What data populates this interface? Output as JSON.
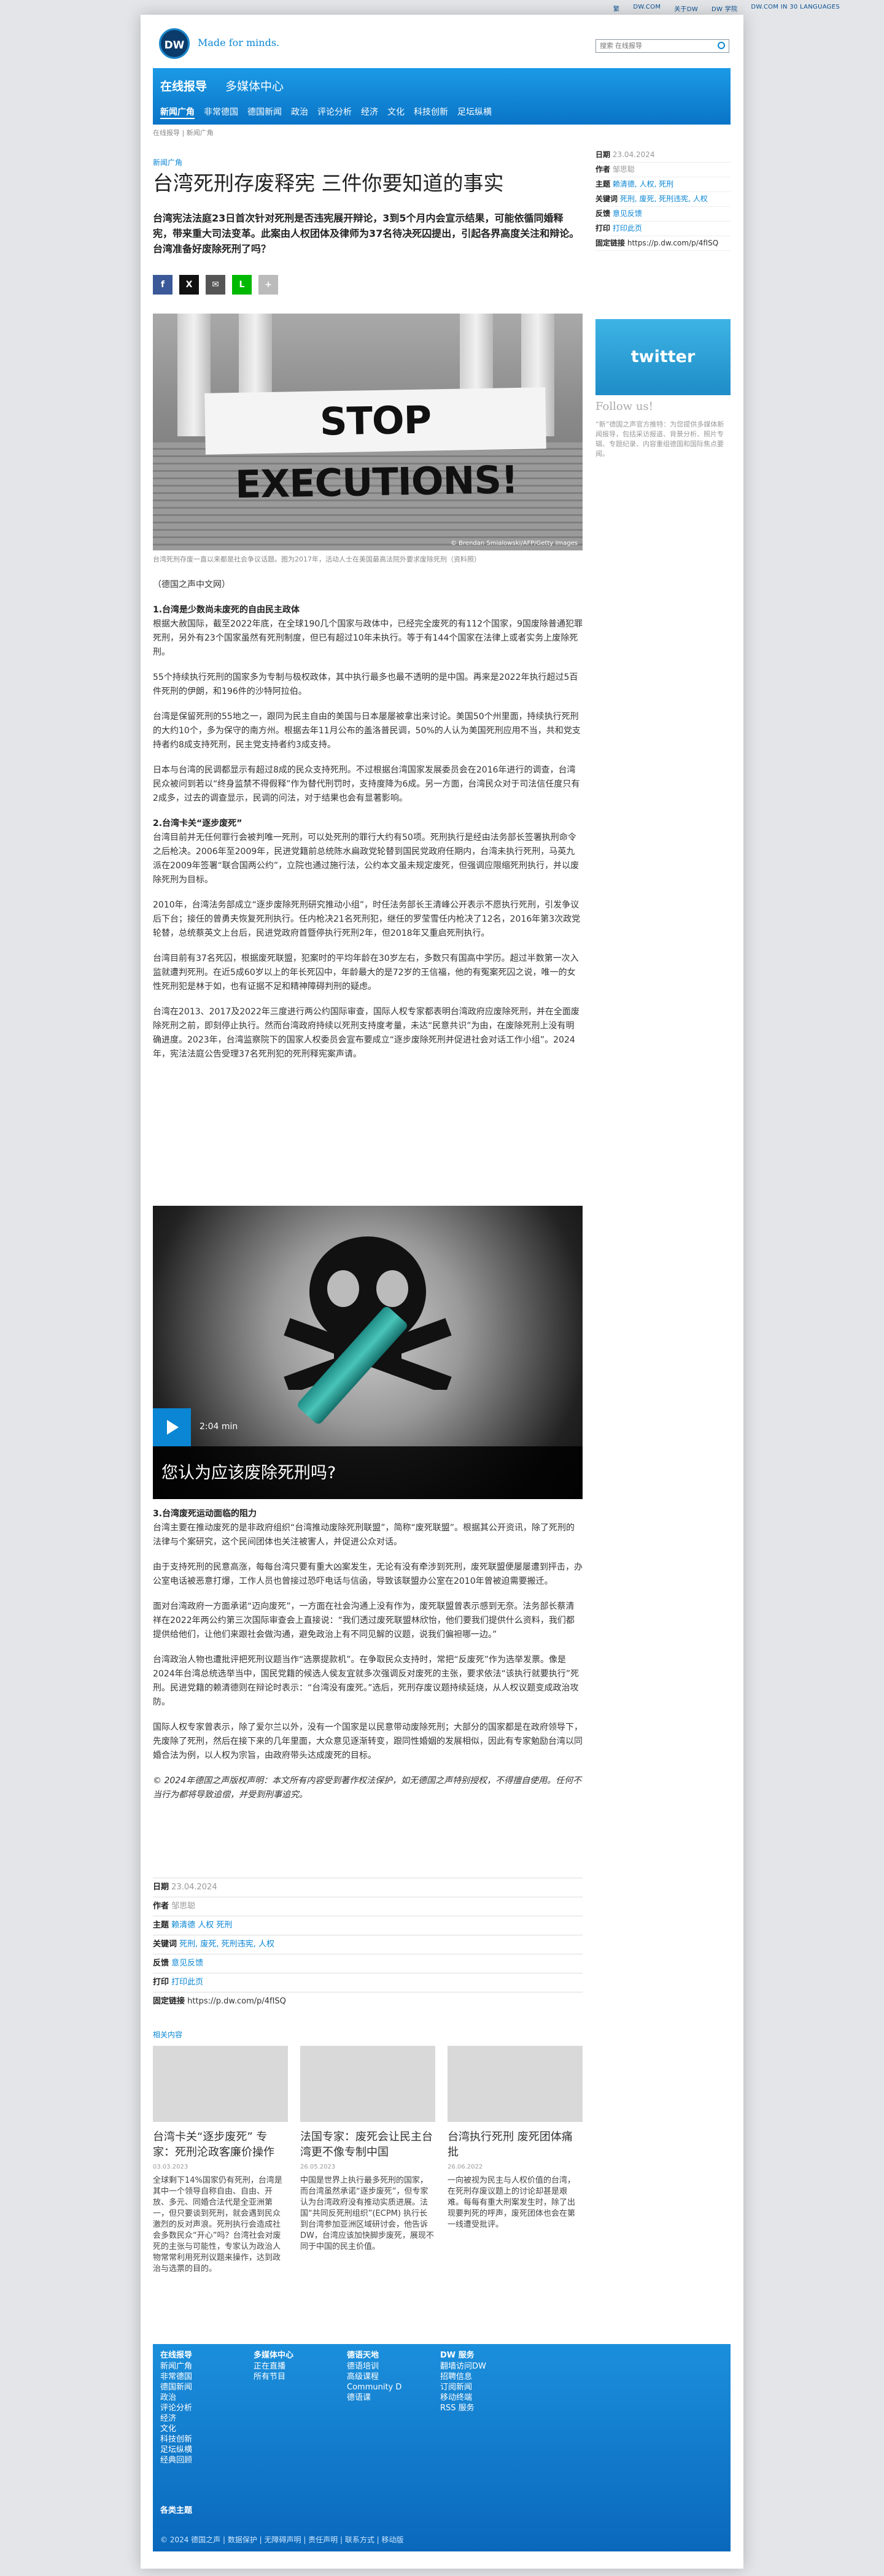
{
  "toplinks": [
    "繁",
    "DW.COM",
    "关于DW",
    "DW 学院",
    "DW.COM IN 30 LANGUAGES"
  ],
  "header": {
    "logo": "DW",
    "tagline": "Made for minds.",
    "search_placeholder": "搜索 在线报导"
  },
  "nav": {
    "title": "在线报导",
    "subtitle": "多媒体中心",
    "items": [
      "新闻广角",
      "非常德国",
      "德国新闻",
      "政治",
      "评论分析",
      "经济",
      "文化",
      "科技创新",
      "足坛纵横"
    ]
  },
  "breadcrumb": "在线报导 | 新闻广角",
  "article": {
    "kicker": "新闻广角",
    "title": "台湾死刑存废释宪 三件你要知道的事实",
    "lead": "台湾宪法法庭23日首次针对死刑是否违宪展开辩论，3到5个月内会宣示结果，可能依循同婚释宪，带来重大司法变革。此案由人权团体及律师为37名待决死囚提出，引起各界高度关注和辩论。台湾准备好废除死刑了吗？",
    "share": [
      "f",
      "X",
      "✉",
      "L",
      "+"
    ],
    "photo_banner": "STOP EXECUTIONS!",
    "photo_credit": "© Brendan Smialowski/AFP/Getty Images",
    "caption": "台湾死刑存废一直以来都是社会争议话题。图为2017年，活动人士在美国最高法院外要求废除死刑（资料照）",
    "sections": [
      {
        "h": "",
        "p": [
          "（德国之声中文网）"
        ]
      },
      {
        "h": "1.台湾是少数尚未废死的自由民主政体",
        "p": [
          "根据大赦国际，截至2022年底，在全球190几个国家与政体中，已经完全废死的有112个国家，9国废除普通犯罪死刑，另外有23个国家虽然有死刑制度，但已有超过10年未执行。等于有144个国家在法律上或者实务上废除死刑。",
          "55个持续执行死刑的国家多为专制与极权政体，其中执行最多也最不透明的是中国。再来是2022年执行超过5百件死刑的伊朗，和196件的沙特阿拉伯。",
          "台湾是保留死刑的55地之一，跟同为民主自由的美国与日本屡屡被拿出来讨论。美国50个州里面，持续执行死刑的大约10个，多为保守的南方州。根据去年11月公布的盖洛普民调，50%的人认为美国死刑应用不当，共和党支持者约8成支持死刑，民主党支持者约3成支持。",
          "日本与台湾的民调都显示有超过8成的民众支持死刑。不过根据台湾国家发展委员会在2016年进行的调查，台湾民众被问到若以“终身监禁不得假释”作为替代刑罚时，支持度降为6成。另一方面，台湾民众对于司法信任度只有2成多，过去的调查显示，民调的问法，对于结果也会有显著影响。"
        ]
      },
      {
        "h": "2.台湾卡关“逐步废死”",
        "p": [
          "台湾目前并无任何罪行会被判唯一死刑，可以处死刑的罪行大约有50项。死刑执行是经由法务部长签署执刑命令之后枪决。2006年至2009年，民进党籍前总统陈水扁政党轮替到国民党政府任期内，台湾未执行死刑，马英九派在2009年签署“联合国两公约”，立院也通过施行法，公约本文虽未规定废死，但强调应限缩死刑执行，并以废除死刑为目标。",
          "2010年，台湾法务部成立“逐步废除死刑研究推动小组”，时任法务部长王清峰公开表示不愿执行死刑，引发争议后下台；接任的曾勇夫恢复死刑执行。任内枪决21名死刑犯，继任的罗莹雪任内枪决了12名，2016年第3次政党轮替，总统蔡英文上台后，民进党政府首暨停执行死刑2年，但2018年又重启死刑执行。",
          "台湾目前有37名死囚，根据废死联盟，犯案时的平均年龄在30岁左右，多数只有国高中学历。超过半数第一次入监就遭判死刑。在近5成60岁以上的年长死囚中，年龄最大的是72岁的王信福，他的有冤案死囚之说，唯一的女性死刑犯是林于如，也有证据不足和精神障碍判刑的疑虑。",
          "台湾在2013、2017及2022年三度进行两公约国际审查，国际人权专家都表明台湾政府应废除死刑，并在全面废除死刑之前，即刻停止执行。然而台湾政府持续以死刑支持度考量，未达“民意共识”为由，在废除死刑上没有明确进度。2023年，台湾监察院下的国家人权委员会宣布要成立“逐步废除死刑并促进社会对话工作小组”。2024年，宪法法庭公告受理37名死刑犯的死刑释宪案声请。"
        ]
      }
    ],
    "video": {
      "duration": "2:04 min",
      "title": "您认为应该废除死刑吗?"
    },
    "sections2": [
      {
        "h": "3.台湾废死运动面临的阻力",
        "p": [
          "台湾主要在推动废死的是非政府组织“台湾推动废除死刑联盟”，简称“废死联盟”。根据其公开资讯，除了死刑的法律与个案研究，这个民间团体也关注被害人，并促进公众对话。",
          "由于支持死刑的民意高涨，每每台湾只要有重大凶案发生，无论有没有牵涉到死刑，废死联盟便屡屡遭到抨击，办公室电话被恶意打爆，工作人员也曾接过恐吓电话与信函，导致该联盟办公室在2010年曾被迫需要搬迁。",
          "面对台湾政府一方面承诺“迈向废死”，一方面在社会沟通上没有作为，废死联盟曾表示感到无奈。法务部长蔡清祥在2022年两公约第三次国际审查会上直接说：“我们透过废死联盟林欣怡，他们要我们提供什么资料，我们都提供给他们，让他们来跟社会做沟通，避免政治上有不同见解的议题，说我们偏袒哪一边。”",
          "台湾政治人物也遭批评把死刑议题当作“选票提款机”。在争取民众支持时，常把“反废死”作为选举发票。像是2024年台湾总统选举当中，国民党籍的候选人侯友宜就多次强调反对废死的主张，要求依法“该执行就要执行”死刑。民进党籍的赖清德则在辩论时表示：“台湾没有废死。”选后，死刑存废议题持续延烧，从人权议题变成政治攻防。",
          "国际人权专家曾表示，除了爱尔兰以外，没有一个国家是以民意带动废除死刑；大部分的国家都是在政府领导下，先废除了死刑，然后在接下来的几年里面，大众意见逐渐转变，跟同性婚姻的发展相似，因此有专家勉励台湾以同婚合法为例，以人权为宗旨，由政府带头达成废死的目标。"
        ]
      }
    ],
    "copyright": "© 2024年德国之声版权声明：本文所有内容受到著作权法保护，如无德国之声特别授权，不得擅自使用。任何不当行为都将导致追偿，并受到刑事追究。"
  },
  "meta": [
    {
      "k": "日期",
      "v": "23.04.2024"
    },
    {
      "k": "作者",
      "v": "邹思聪"
    },
    {
      "k": "主题",
      "v": "赖清德 人权 死刑"
    },
    {
      "k": "关键词",
      "v": "死刑, 废死, 死刑违宪, 人权"
    },
    {
      "k": "反馈",
      "v": "意见反馈"
    },
    {
      "k": "打印",
      "v": "打印此页"
    },
    {
      "k": "固定链接",
      "v": "https://p.dw.com/p/4fISQ"
    }
  ],
  "side": [
    {
      "k": "日期",
      "v": "23.04.2024"
    },
    {
      "k": "作者",
      "v": "邹思聪"
    },
    {
      "k": "主题",
      "v": "赖清德, 人权, 死刑"
    },
    {
      "k": "关键词",
      "v": "死刑, 废死, 死刑违宪, 人权"
    },
    {
      "k": "反馈",
      "v": "意见反馈"
    },
    {
      "k": "打印",
      "v": "打印此页"
    },
    {
      "k": "固定链接",
      "v": "https://p.dw.com/p/4fISQ"
    }
  ],
  "twitter": "twitter",
  "follow": "Follow us!",
  "follow_text": "“新”德国之声官方推特：为您提供多媒体新闻报导，包括采访报道、背景分析、照片专辑、专题纪录、内容重组德国和国际焦点要闻。",
  "related_heading": "相关内容",
  "related": [
    {
      "t": "台湾卡关“逐步废死” 专家：死刑沦政客廉价操作",
      "d": "03.03.2023",
      "p": "全球剩下14%国家仍有死刑，台湾是其中一个领导自称自由、自由、开放、多元、同婚合法代是全亚洲第一，但只要谈到死刑，就会遇到民众激烈的反对声浪。死刑执行会造成社会多数民众“开心”吗？台湾社会对废死的主张与可能性，专家认为政治人物常常利用死刑议题来操作，达到政治与选票的目的。"
    },
    {
      "t": "法国专家：废死会让民主台湾更不像专制中国",
      "d": "26.05.2023",
      "p": "中国是世界上执行最多死刑的国家，而台湾虽然承诺“逐步废死”，但专家认为台湾政府没有推动实质进展。法国“共同反死刑组织”(ECPM) 执行长到台湾参加亚洲区域研讨会，他告诉DW，台湾应该加快脚步废死，展现不同于中国的民主价值。"
    },
    {
      "t": "台湾执行死刑 废死团体痛批",
      "d": "26.06.2022",
      "p": "一向被视为民主与人权价值的台湾，在死刑存废议题上的讨论却甚是艰难。每每有重大刑案发生时，除了出现要判死的呼声，废死团体也会在第一线遭受批评。"
    }
  ],
  "footer": {
    "cols": [
      {
        "h": "在线报导",
        "items": [
          "新闻广角",
          "非常德国",
          "德国新闻",
          "政治",
          "评论分析",
          "经济",
          "文化",
          "科技创新",
          "足坛纵横",
          "经典回顾"
        ]
      },
      {
        "h": "多媒体中心",
        "items": [
          "正在直播",
          "所有节目"
        ]
      },
      {
        "h": "德语天地",
        "items": [
          "德语培训",
          "高级课程",
          "Community D",
          "德语课"
        ]
      },
      {
        "h": "DW 服务",
        "items": [
          "翻墙访问DW",
          "招聘信息",
          "订阅新闻",
          "移动终端",
          "RSS 服务"
        ]
      }
    ],
    "addresses": "各类主题",
    "bottom": "© 2024 德国之声 | 数据保护 | 无障碍声明 | 责任声明 | 联系方式 | 移动版"
  }
}
